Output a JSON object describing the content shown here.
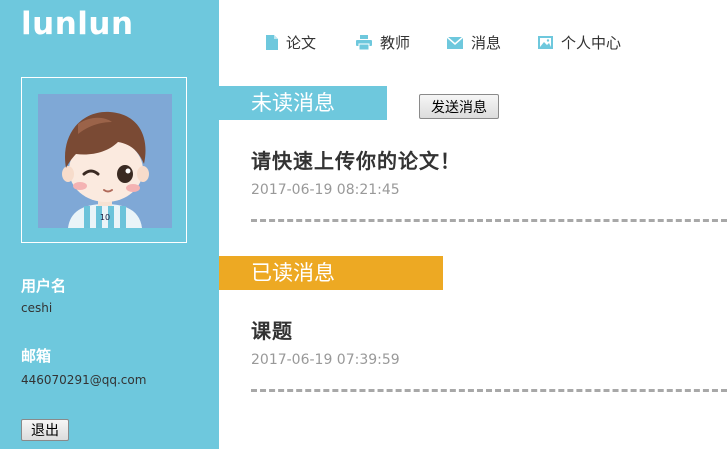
{
  "brand": {
    "logo": "lunlun"
  },
  "user": {
    "username_label": "用户名",
    "username": "ceshi",
    "email_label": "邮箱",
    "email": "446070291@qq.com",
    "logout_label": "退出"
  },
  "nav": {
    "items": [
      {
        "label": "论文",
        "icon": "document-icon"
      },
      {
        "label": "教师",
        "icon": "printer-icon"
      },
      {
        "label": "消息",
        "icon": "envelope-icon"
      },
      {
        "label": "个人中心",
        "icon": "image-icon"
      }
    ]
  },
  "unread": {
    "header": "未读消息",
    "send_button": "发送消息",
    "messages": [
      {
        "title": "请快速上传你的论文！",
        "time": "2017-06-19 08:21:45"
      }
    ]
  },
  "read": {
    "header": "已读消息",
    "messages": [
      {
        "title": "课题",
        "time": "2017-06-19 07:39:59"
      }
    ]
  },
  "colors": {
    "sidebar": "#6ec8dd",
    "unread_header": "#6ec8dd",
    "read_header": "#eda923",
    "nav_icon": "#6ec8dd"
  }
}
